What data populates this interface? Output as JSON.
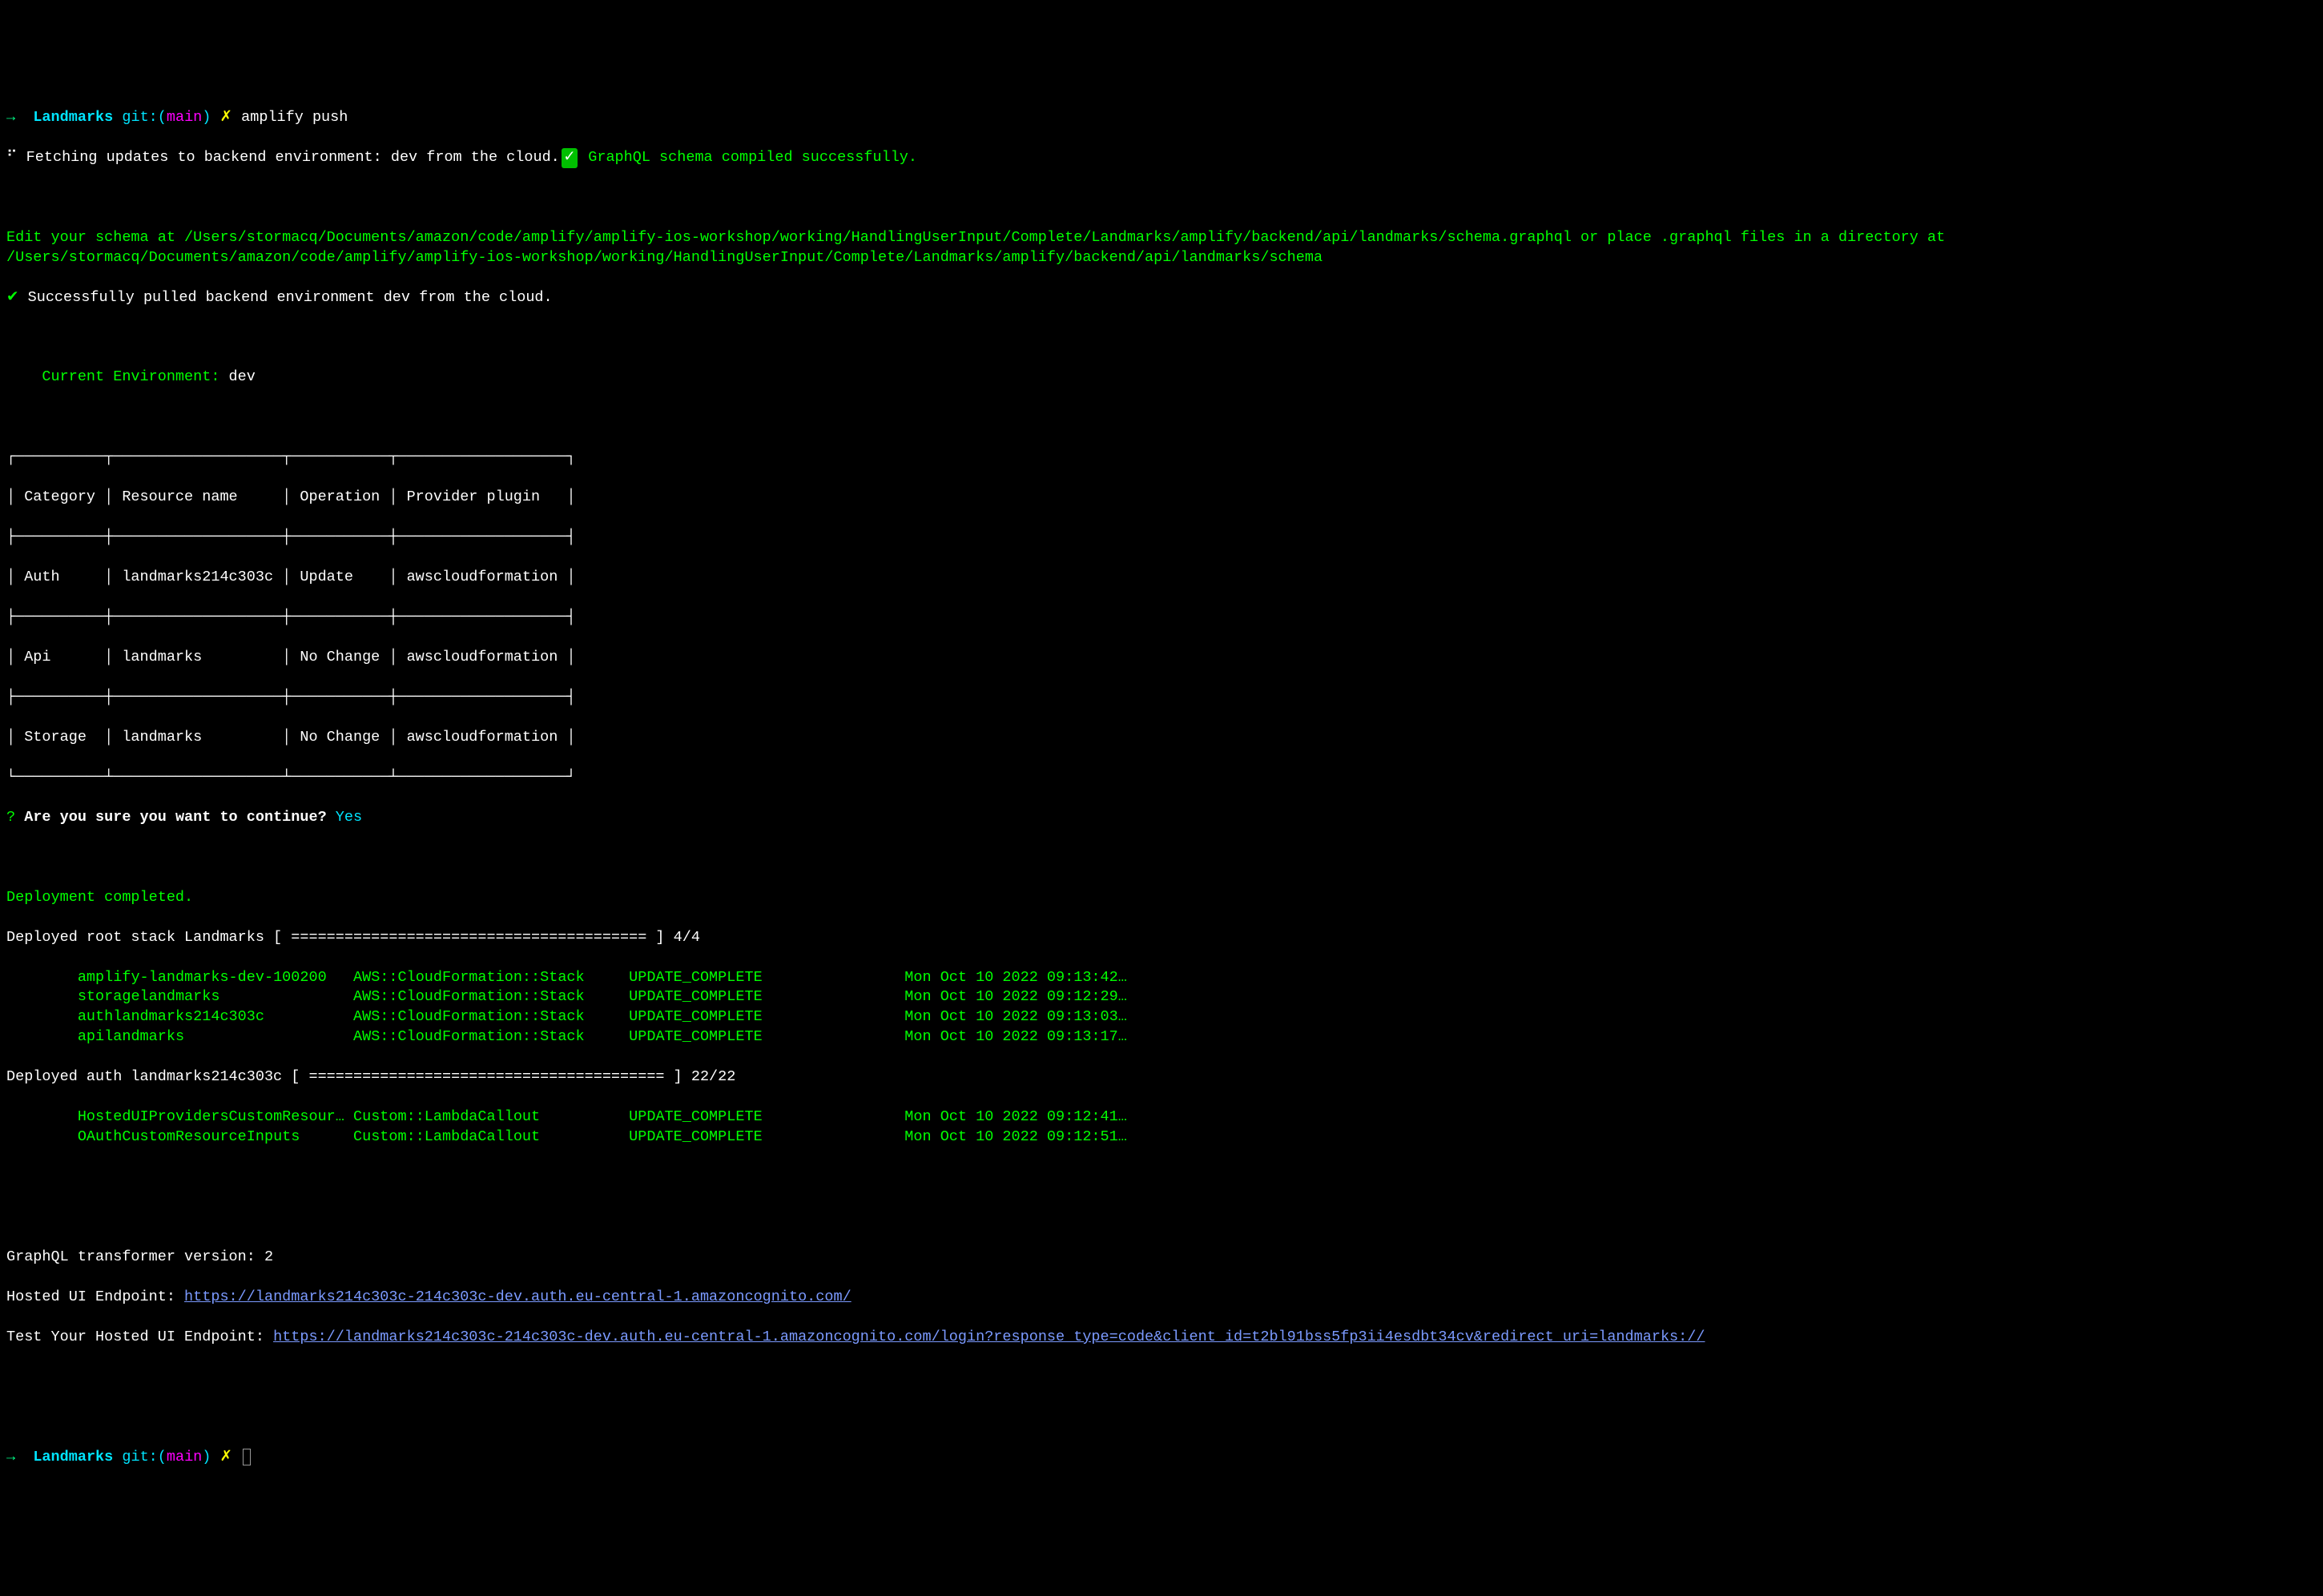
{
  "prompt1": {
    "arrow": "→",
    "dir": "Landmarks",
    "git_label": "git:(",
    "branch": "main",
    "git_close": ")",
    "marker": "✗",
    "command": "amplify push"
  },
  "fetching": {
    "spinner": "⠋",
    "text": "Fetching updates to backend environment: dev from the cloud.",
    "compiled": "GraphQL schema compiled successfully."
  },
  "edit_schema_line": "Edit your schema at /Users/stormacq/Documents/amazon/code/amplify/amplify-ios-workshop/working/HandlingUserInput/Complete/Landmarks/amplify/backend/api/landmarks/schema.graphql or place .graphql files in a directory at /Users/stormacq/Documents/amazon/code/amplify/amplify-ios-workshop/working/HandlingUserInput/Complete/Landmarks/amplify/backend/api/landmarks/schema",
  "pulled": {
    "check": "✔",
    "text": "Successfully pulled backend environment dev from the cloud."
  },
  "env": {
    "label": "    Current Environment:",
    "value": " dev"
  },
  "table": {
    "border_top": "┌──────────┬───────────────────┬───────────┬───────────────────┐",
    "header": "│ Category │ Resource name     │ Operation │ Provider plugin   │",
    "sep": "├──────────┼───────────────────┼───────────┼───────────────────┤",
    "rows": [
      "│ Auth     │ landmarks214c303c │ Update    │ awscloudformation │",
      "│ Api      │ landmarks         │ No Change │ awscloudformation │",
      "│ Storage  │ landmarks         │ No Change │ awscloudformation │"
    ],
    "border_bottom": "└──────────┴───────────────────┴───────────┴───────────────────┘"
  },
  "confirm": {
    "q": "?",
    "text": "Are you sure you want to continue?",
    "ans": "Yes"
  },
  "deployment_completed": "Deployment completed.",
  "deployed_root": {
    "line": "Deployed root stack Landmarks [ ======================================== ] 4/4",
    "items": [
      {
        "name": "amplify-landmarks-dev-100200",
        "type": "AWS::CloudFormation::Stack",
        "status": "UPDATE_COMPLETE",
        "ts": "Mon Oct 10 2022 09:13:42…"
      },
      {
        "name": "storagelandmarks",
        "type": "AWS::CloudFormation::Stack",
        "status": "UPDATE_COMPLETE",
        "ts": "Mon Oct 10 2022 09:12:29…"
      },
      {
        "name": "authlandmarks214c303c",
        "type": "AWS::CloudFormation::Stack",
        "status": "UPDATE_COMPLETE",
        "ts": "Mon Oct 10 2022 09:13:03…"
      },
      {
        "name": "apilandmarks",
        "type": "AWS::CloudFormation::Stack",
        "status": "UPDATE_COMPLETE",
        "ts": "Mon Oct 10 2022 09:13:17…"
      }
    ]
  },
  "deployed_auth": {
    "line": "Deployed auth landmarks214c303c [ ======================================== ] 22/22",
    "items": [
      {
        "name": "HostedUIProvidersCustomResour…",
        "type": "Custom::LambdaCallout",
        "status": "UPDATE_COMPLETE",
        "ts": "Mon Oct 10 2022 09:12:41…"
      },
      {
        "name": "OAuthCustomResourceInputs",
        "type": "Custom::LambdaCallout",
        "status": "UPDATE_COMPLETE",
        "ts": "Mon Oct 10 2022 09:12:51…"
      }
    ]
  },
  "graphql_transformer": "GraphQL transformer version: 2",
  "hosted_label": "Hosted UI Endpoint: ",
  "hosted_url": "https://landmarks214c303c-214c303c-dev.auth.eu-central-1.amazoncognito.com/",
  "test_label": "Test Your Hosted UI Endpoint: ",
  "test_url": "https://landmarks214c303c-214c303c-dev.auth.eu-central-1.amazoncognito.com/login?response_type=code&client_id=t2bl91bss5fp3ii4esdbt34cv&redirect_uri=landmarks://",
  "prompt2": {
    "arrow": "→",
    "dir": "Landmarks",
    "git_label": "git:(",
    "branch": "main",
    "git_close": ")",
    "marker": "✗"
  }
}
